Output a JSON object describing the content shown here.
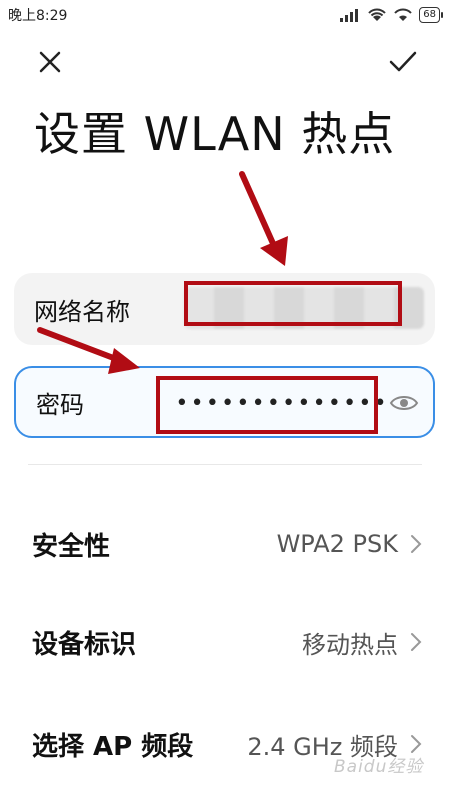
{
  "status_bar": {
    "time": "晚上8:29",
    "battery": "68",
    "signal_icon": "signal-icon",
    "wifi_icon": "wifi-icon"
  },
  "header": {
    "close_icon": "close-icon",
    "confirm_icon": "checkmark-icon",
    "title": "设置 WLAN 热点"
  },
  "form": {
    "ssid_label": "网络名称",
    "password_label": "密码",
    "password_value": "••••••••••••••",
    "visibility_icon": "eye-icon"
  },
  "settings": {
    "security_label": "安全性",
    "security_value": "WPA2 PSK",
    "device_label": "设备标识",
    "device_value": "移动热点",
    "band_label": "选择 AP 频段",
    "band_value": "2.4 GHz 频段"
  },
  "watermark": "Baidu经验",
  "colors": {
    "accent": "#3a8ee6",
    "annotation": "#b10c14",
    "field_bg": "#f3f3f3"
  }
}
